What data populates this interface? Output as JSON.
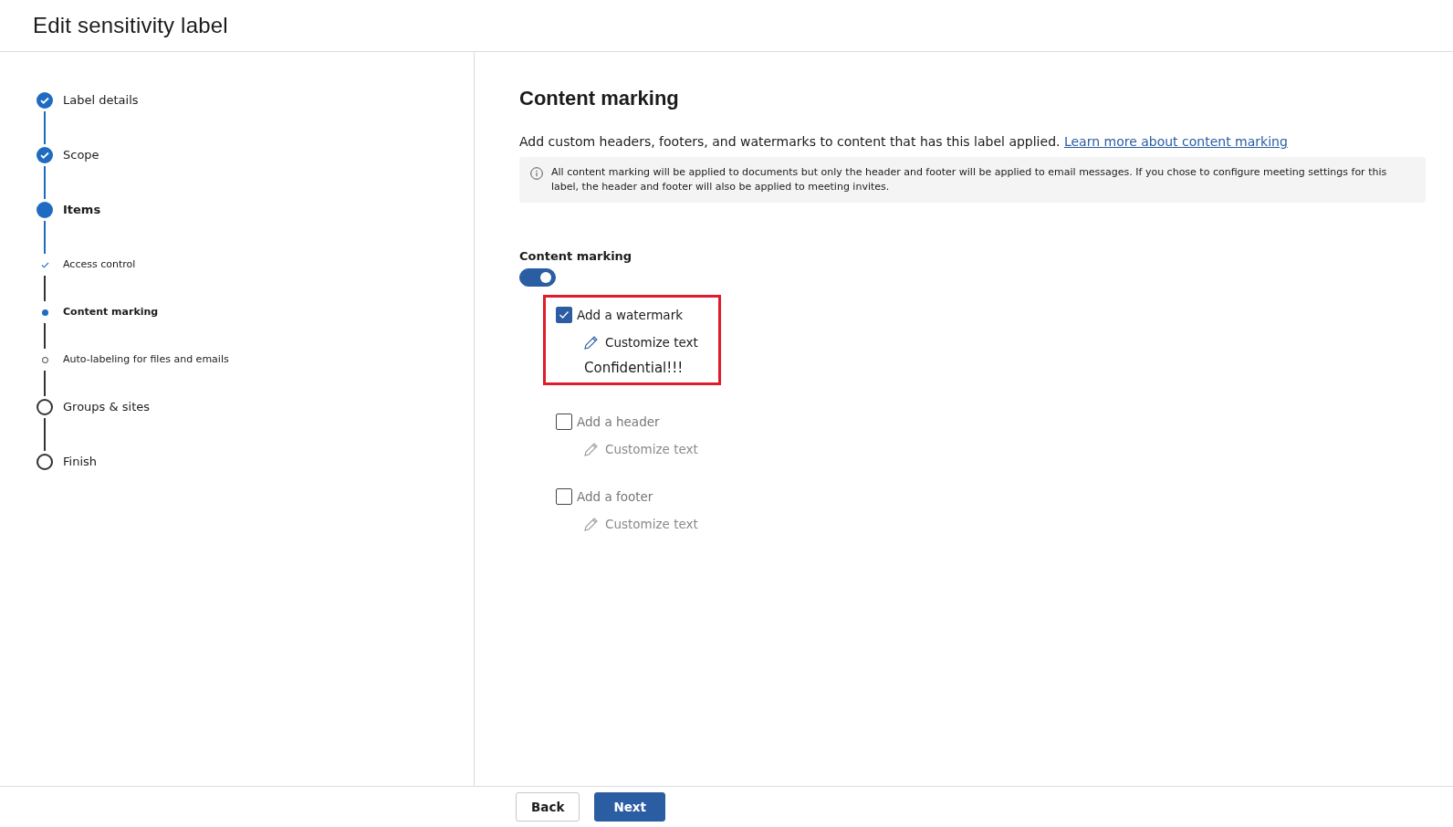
{
  "window": {
    "title": "Edit sensitivity label"
  },
  "steps": [
    {
      "label": "Label details",
      "kind": "major",
      "done": true,
      "current": false
    },
    {
      "label": "Scope",
      "kind": "major",
      "done": true,
      "current": false
    },
    {
      "label": "Items",
      "kind": "major",
      "done": false,
      "current": true
    },
    {
      "label": "Access control",
      "kind": "minor",
      "done": true,
      "current": false
    },
    {
      "label": "Content marking",
      "kind": "minor",
      "done": false,
      "current": true
    },
    {
      "label": "Auto-labeling for files and emails",
      "kind": "minor",
      "done": false,
      "current": false
    },
    {
      "label": "Groups & sites",
      "kind": "major",
      "done": false,
      "current": false
    },
    {
      "label": "Finish",
      "kind": "major",
      "done": false,
      "current": false
    }
  ],
  "content": {
    "heading": "Content marking",
    "description": "Add custom headers, footers, and watermarks to content that has this label applied.",
    "link": "Learn more about content marking",
    "info": "All content marking will be applied to documents but only the header and footer will be applied to email messages. If you chose to configure meeting settings for this label, the header and footer will also be applied to meeting invites.",
    "toggle": {
      "label": "Content marking",
      "on": true
    },
    "options": [
      {
        "label": "Add a watermark",
        "checked": true,
        "highlighted": true,
        "action": "Customize text",
        "value": "Confidential!!!"
      },
      {
        "label": "Add a header",
        "checked": false,
        "highlighted": false,
        "action": "Customize text"
      },
      {
        "label": "Add a footer",
        "checked": false,
        "highlighted": false,
        "action": "Customize text"
      }
    ]
  },
  "buttons": [
    {
      "label": "Back",
      "kind": "secondary"
    },
    {
      "label": "Next",
      "kind": "primary"
    }
  ]
}
